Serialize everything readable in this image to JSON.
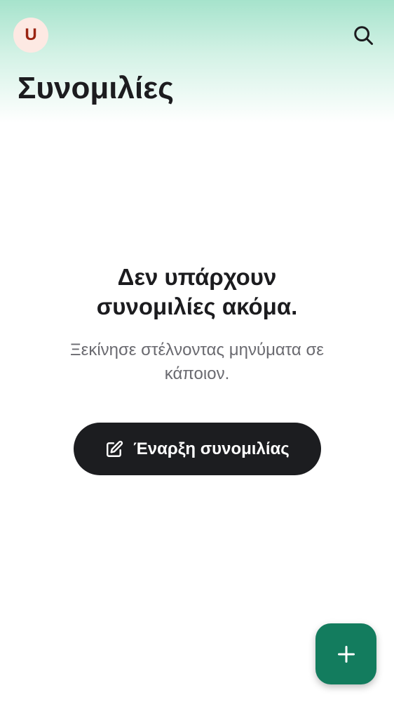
{
  "header": {
    "avatar_initial": "U",
    "title": "Συνομιλίες",
    "search_icon": "search-icon"
  },
  "empty_state": {
    "title": "Δεν υπάρχουν συνομιλίες ακόμα.",
    "subtitle": "Ξεκίνησε στέλνοντας μηνύματα σε κάποιον.",
    "button_label": "Έναρξη συνομιλίας",
    "button_icon": "edit-icon"
  },
  "fab": {
    "icon": "plus-icon"
  },
  "colors": {
    "header_gradient_top": "#a6e3cc",
    "avatar_bg": "#fde9e3",
    "avatar_text": "#9a2411",
    "primary_dark": "#1c1d20",
    "fab_bg": "#137c5e",
    "subtitle_text": "#6a6a70"
  }
}
